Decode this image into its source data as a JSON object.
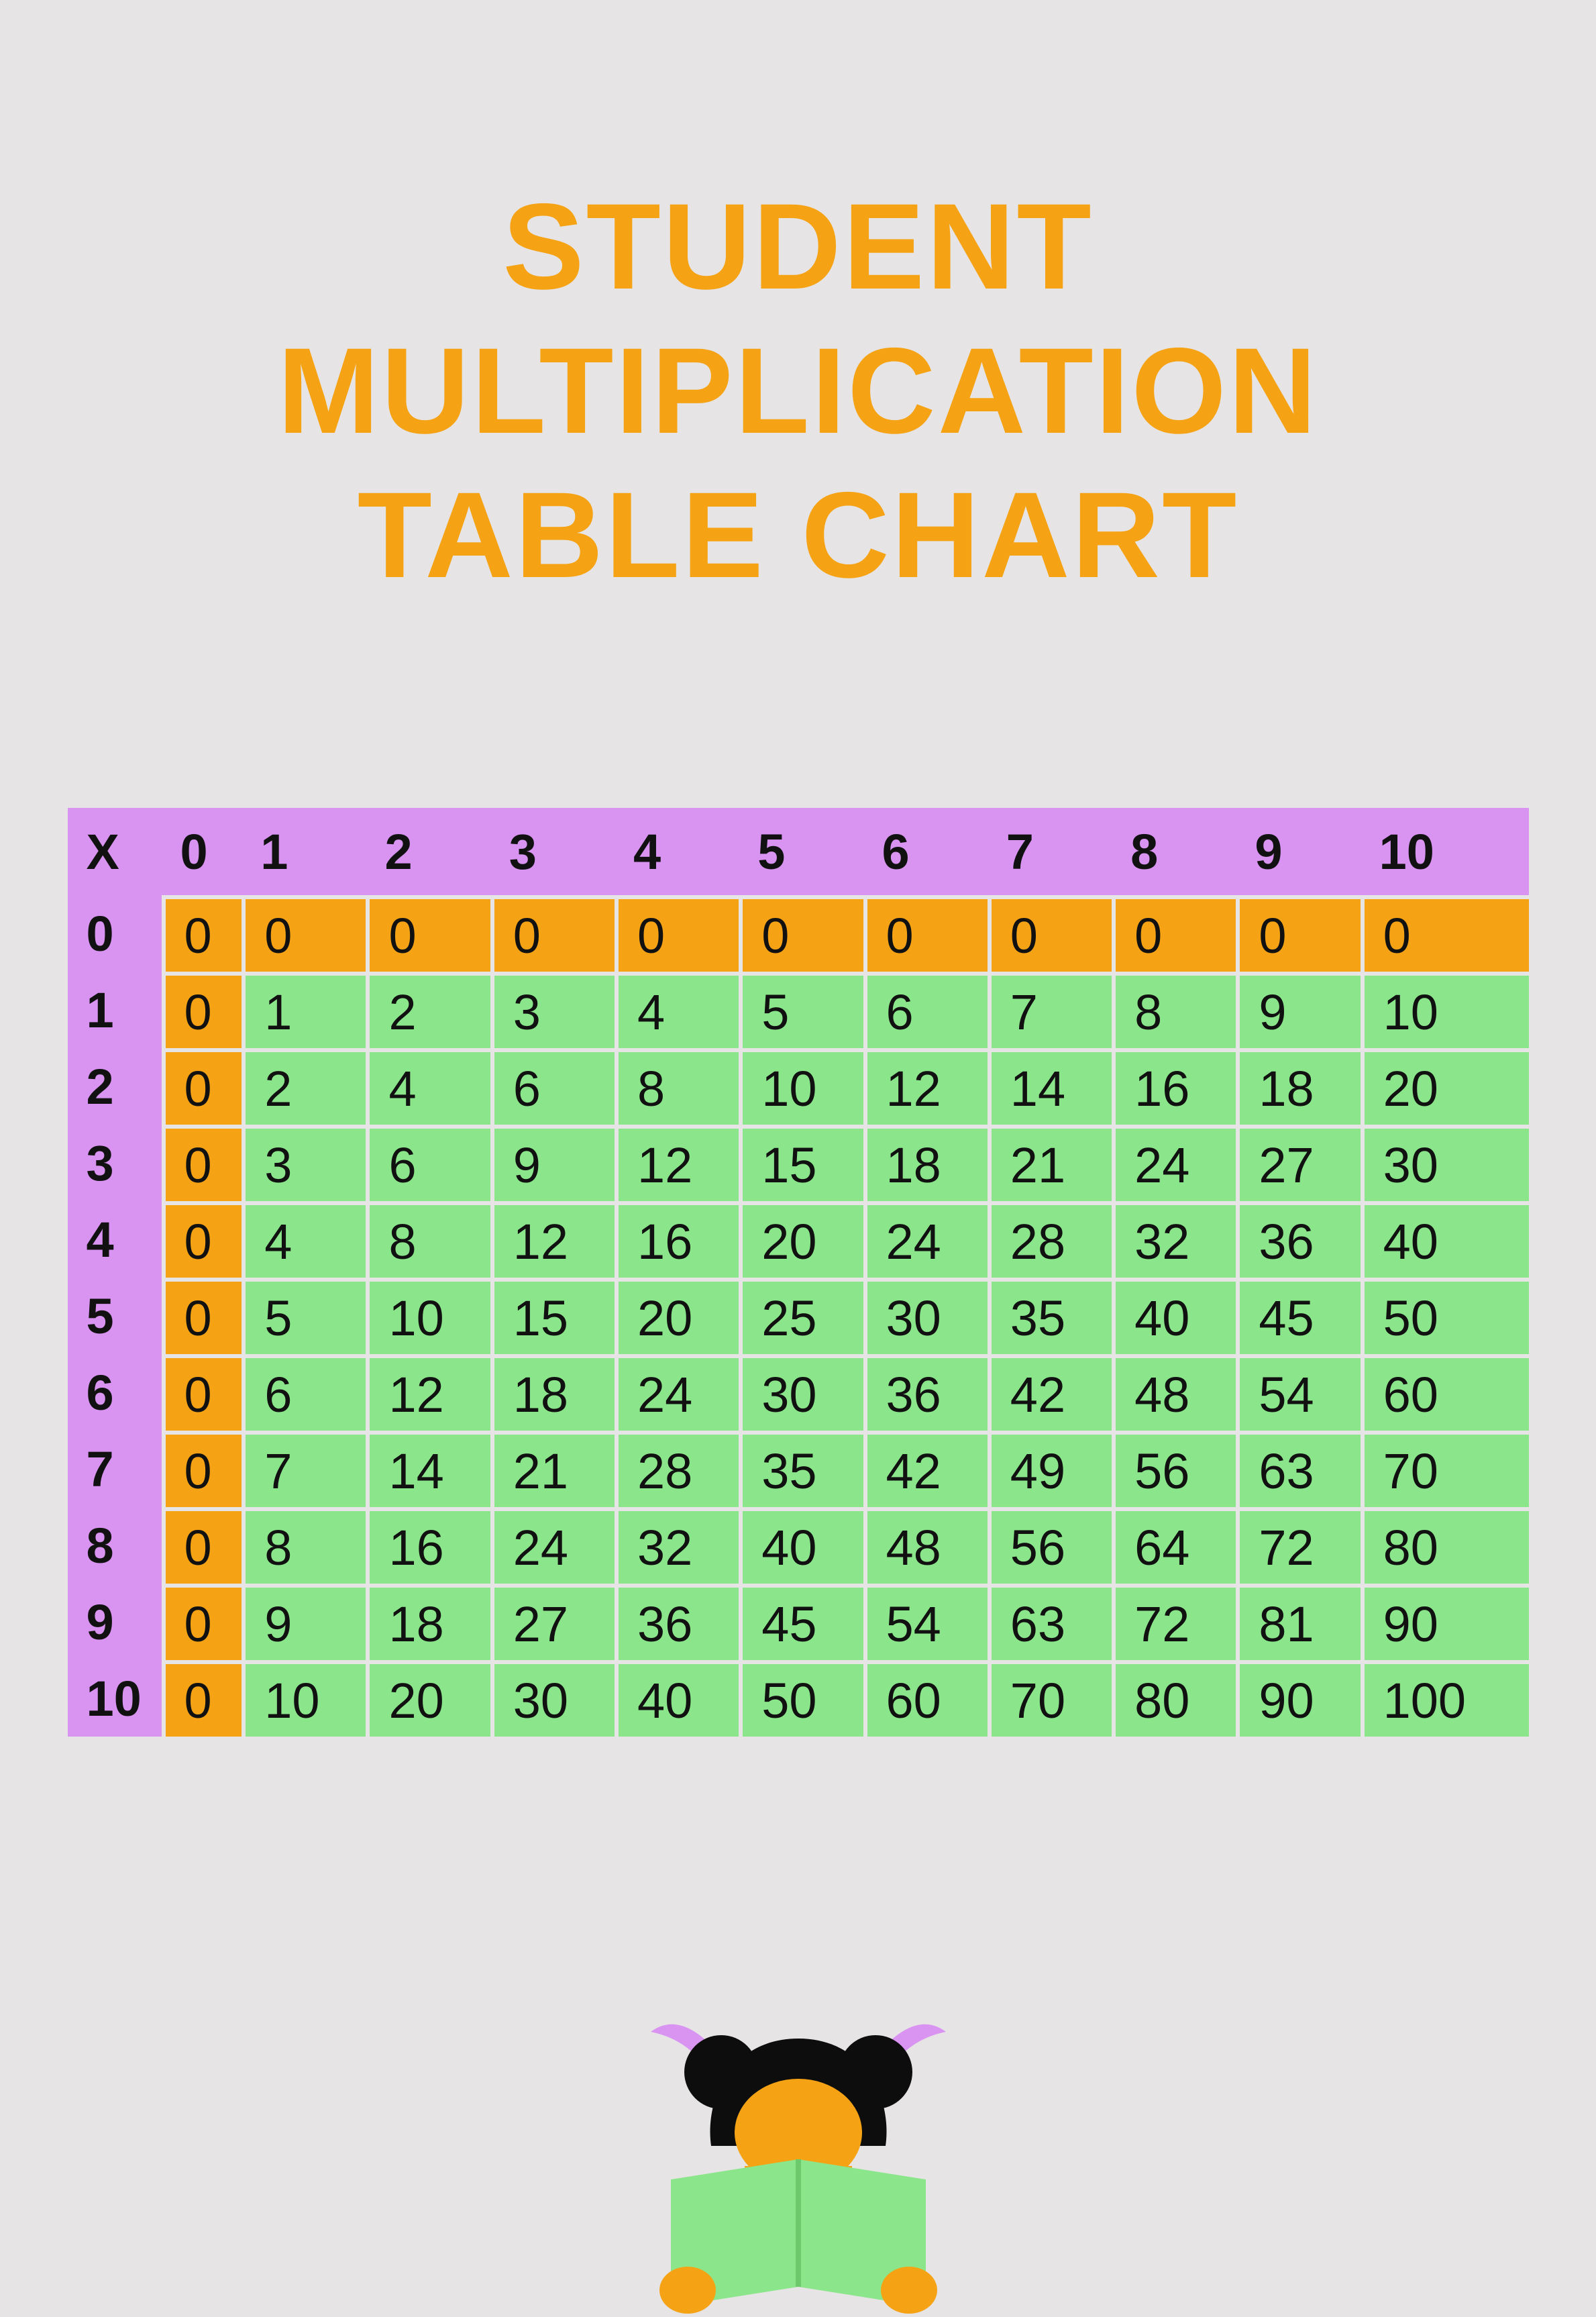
{
  "title_line1": "STUDENT",
  "title_line2": "MULTIPLICATION",
  "title_line3": "TABLE CHART",
  "chart_data": {
    "type": "table",
    "title": "Student Multiplication Table Chart",
    "corner": "X",
    "col_headers": [
      "0",
      "1",
      "2",
      "3",
      "4",
      "5",
      "6",
      "7",
      "8",
      "9",
      "10"
    ],
    "row_headers": [
      "0",
      "1",
      "2",
      "3",
      "4",
      "5",
      "6",
      "7",
      "8",
      "9",
      "10"
    ],
    "rows": [
      [
        0,
        0,
        0,
        0,
        0,
        0,
        0,
        0,
        0,
        0,
        0
      ],
      [
        0,
        1,
        2,
        3,
        4,
        5,
        6,
        7,
        8,
        9,
        10
      ],
      [
        0,
        2,
        4,
        6,
        8,
        10,
        12,
        14,
        16,
        18,
        20
      ],
      [
        0,
        3,
        6,
        9,
        12,
        15,
        18,
        21,
        24,
        27,
        30
      ],
      [
        0,
        4,
        8,
        12,
        16,
        20,
        24,
        28,
        32,
        36,
        40
      ],
      [
        0,
        5,
        10,
        15,
        20,
        25,
        30,
        35,
        40,
        45,
        50
      ],
      [
        0,
        6,
        12,
        18,
        24,
        30,
        36,
        42,
        48,
        54,
        60
      ],
      [
        0,
        7,
        14,
        21,
        28,
        35,
        42,
        49,
        56,
        63,
        70
      ],
      [
        0,
        8,
        16,
        24,
        32,
        40,
        48,
        56,
        64,
        72,
        80
      ],
      [
        0,
        9,
        18,
        27,
        36,
        45,
        54,
        63,
        72,
        81,
        90
      ],
      [
        0,
        10,
        20,
        30,
        40,
        50,
        60,
        70,
        80,
        90,
        100
      ]
    ],
    "colors": {
      "header_bg": "#d994f2",
      "zero_bg": "#f5a315",
      "cell_bg": "#8be68b",
      "title_color": "#f5a315",
      "page_bg": "#e6e4e4"
    }
  }
}
